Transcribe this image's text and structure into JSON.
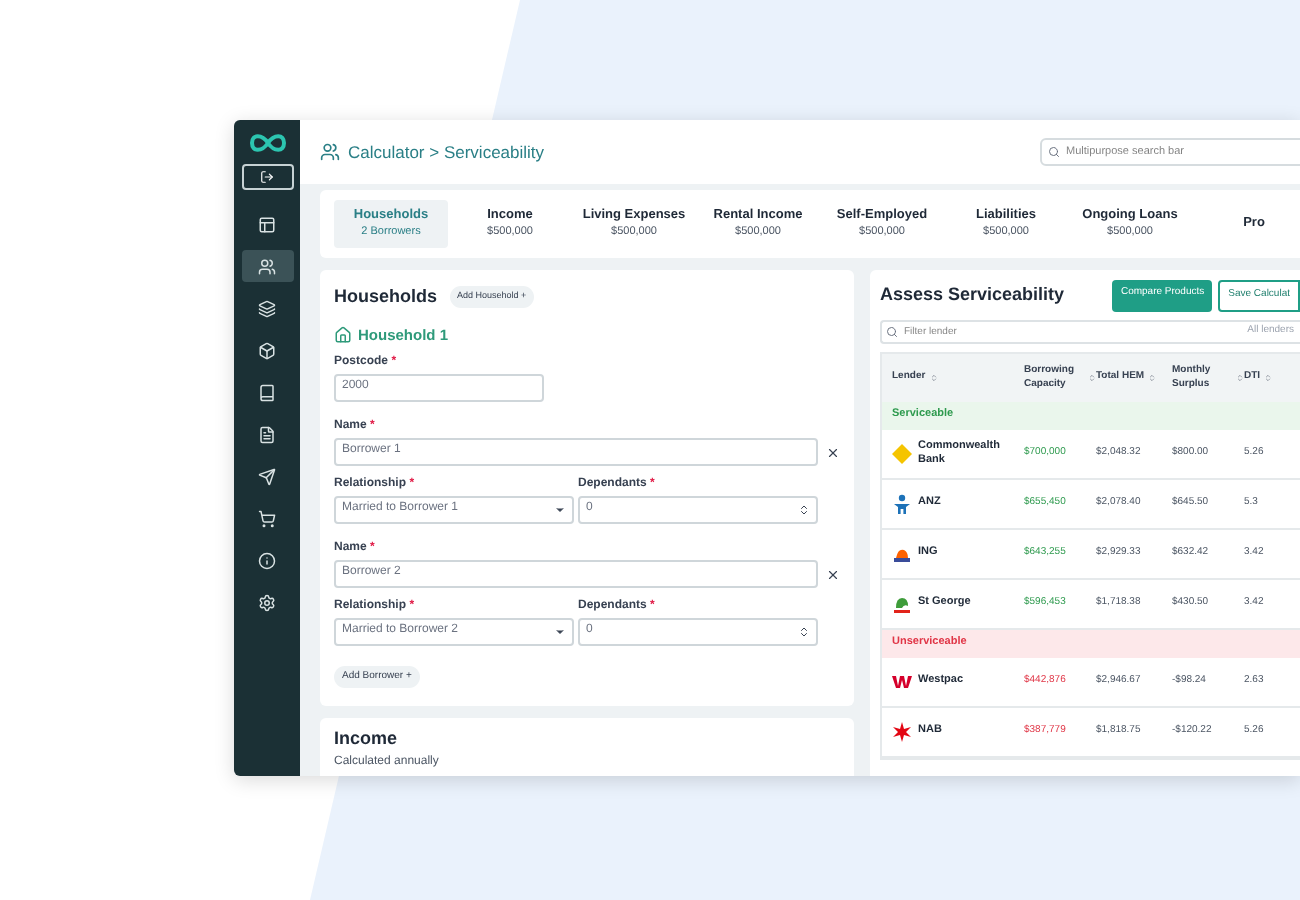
{
  "sidebar": {
    "items": [
      {
        "selected": false
      },
      {
        "selected": true
      },
      {
        "selected": false
      },
      {
        "selected": false
      },
      {
        "selected": false
      },
      {
        "selected": false
      },
      {
        "selected": false
      },
      {
        "selected": false
      },
      {
        "selected": false
      },
      {
        "selected": false
      }
    ]
  },
  "header": {
    "breadcrumb": "Calculator > Serviceability",
    "search": {
      "placeholder": "Multipurpose search bar"
    }
  },
  "tabs": [
    {
      "label": "Households",
      "value": "2 Borrowers",
      "selected": true
    },
    {
      "label": "Income",
      "value": "$500,000",
      "selected": false
    },
    {
      "label": "Living Expenses",
      "value": "$500,000",
      "selected": false
    },
    {
      "label": "Rental Income",
      "value": "$500,000",
      "selected": false
    },
    {
      "label": "Self-Employed",
      "value": "$500,000",
      "selected": false
    },
    {
      "label": "Liabilities",
      "value": "$500,000",
      "selected": false
    },
    {
      "label": "Ongoing Loans",
      "value": "$500,000",
      "selected": false
    },
    {
      "label": "Pro",
      "selected": false
    }
  ],
  "households": {
    "title": "Households",
    "add_button": "Add Household +",
    "household": "Household 1",
    "postcode": {
      "label": "Postcode",
      "mark": "*",
      "value": "2000"
    },
    "borrowers": [
      {
        "name": {
          "label": "Name",
          "mark": "*",
          "value": "Borrower 1"
        },
        "relationship": {
          "label": "Relationship",
          "mark": "*",
          "value": "Married to Borrower 1"
        },
        "dependants": {
          "label": "Dependants",
          "mark": "*",
          "value": "0"
        }
      },
      {
        "name": {
          "label": "Name",
          "mark": "*",
          "value": "Borrower 2"
        },
        "relationship": {
          "label": "Relationship",
          "mark": "*",
          "value": "Married to Borrower 2"
        },
        "dependants": {
          "label": "Dependants",
          "mark": "*",
          "value": "0"
        }
      }
    ],
    "add_borrower": "Add Borrower +"
  },
  "income": {
    "title": "Income",
    "subtitle": "Calculated annually"
  },
  "assess": {
    "title": "Assess Serviceability",
    "buttons": [
      "Compare Products",
      "Save Calculat"
    ],
    "filter": {
      "placeholder": "Filter lender",
      "scope": "All lenders"
    },
    "columns": [
      "Lender",
      "Borrowing Capacity",
      "Total HEM",
      "Monthly Surplus",
      "DTI"
    ],
    "groups": [
      {
        "kind": "serviceable",
        "label": "Serviceable",
        "rows": [
          {
            "kind": "diamond",
            "lender": "Commonwealth Bank",
            "capacity": "$700,000",
            "hem": "$2,048.32",
            "surplus": "$800.00",
            "dti": "5.26"
          },
          {
            "kind": "people",
            "lender": "ANZ",
            "capacity": "$655,450",
            "hem": "$2,078.40",
            "surplus": "$645.50",
            "dti": "5.3"
          },
          {
            "kind": "lion",
            "lender": "ING",
            "capacity": "$643,255",
            "hem": "$2,929.33",
            "surplus": "$632.42",
            "dti": "3.42"
          },
          {
            "kind": "dragon",
            "lender": "St George",
            "capacity": "$596,453",
            "hem": "$1,718.38",
            "surplus": "$430.50",
            "dti": "3.42"
          }
        ]
      },
      {
        "kind": "unserviceable",
        "label": "Unserviceable",
        "rows": [
          {
            "kind": "w",
            "lender": "Westpac",
            "capacity": "$442,876",
            "hem": "$2,946.67",
            "surplus": "-$98.24",
            "dti": "2.63"
          },
          {
            "kind": "star",
            "lender": "NAB",
            "capacity": "$387,779",
            "hem": "$1,818.75",
            "surplus": "-$120.22",
            "dti": "5.26"
          }
        ]
      }
    ]
  }
}
